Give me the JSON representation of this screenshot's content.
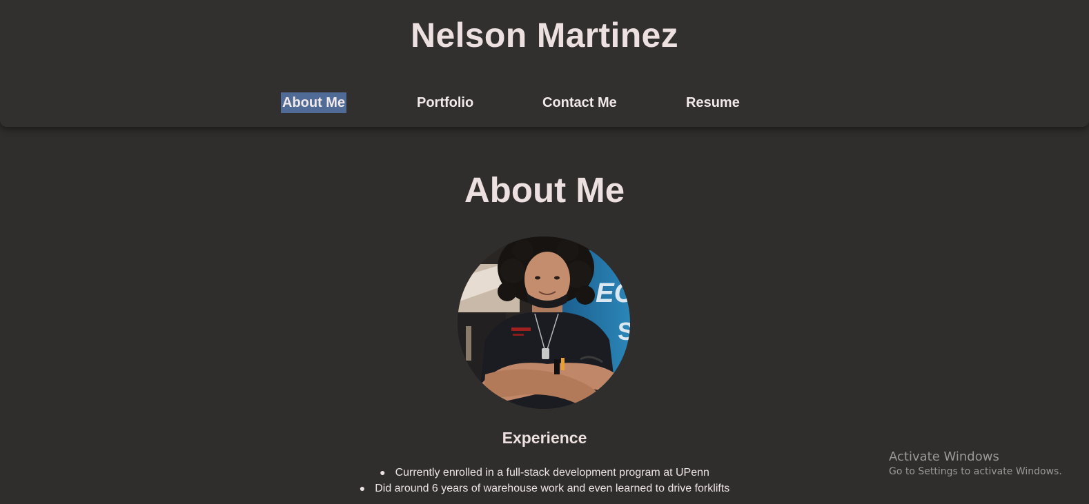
{
  "header": {
    "site_title": "Nelson Martinez",
    "nav": [
      {
        "label": "About Me",
        "selected": true
      },
      {
        "label": "Portfolio",
        "selected": false
      },
      {
        "label": "Contact Me",
        "selected": false
      },
      {
        "label": "Resume",
        "selected": false
      }
    ]
  },
  "main": {
    "section_title": "About Me",
    "avatar": {
      "icon": "profile-photo"
    },
    "experience": {
      "heading": "Experience",
      "items": [
        "Currently enrolled in a full-stack development program at UPenn",
        "Did around 6 years of warehouse work and even learned to drive forklifts"
      ]
    }
  },
  "os_watermark": {
    "title": "Activate Windows",
    "subtitle": "Go to Settings to activate Windows."
  },
  "colors": {
    "background": "#302e2c",
    "header_background": "#32302e",
    "text": "#ece0e0",
    "selection_highlight": "#4f6b96"
  }
}
